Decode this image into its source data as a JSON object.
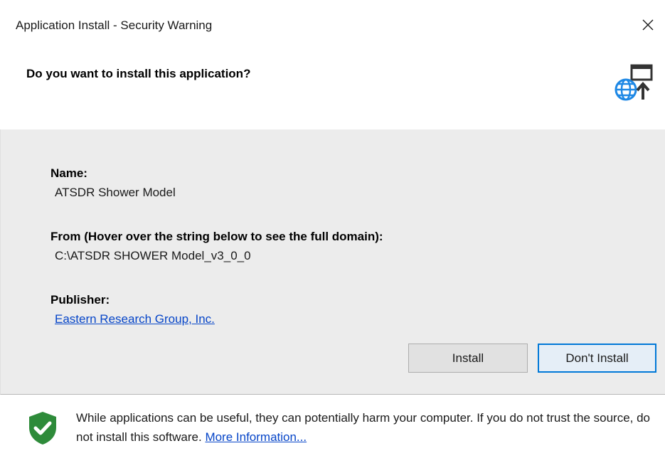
{
  "window": {
    "title": "Application Install - Security Warning",
    "close_icon": "close-icon"
  },
  "header": {
    "question": "Do you want to install this application?",
    "icon": "app-install-globe-icon"
  },
  "details": {
    "name_label": "Name:",
    "name_value": "ATSDR Shower Model",
    "from_label": "From (Hover over the string below to see the full domain):",
    "from_value": "C:\\ATSDR SHOWER Model_v3_0_0",
    "publisher_label": "Publisher:",
    "publisher_value": "Eastern Research Group, Inc."
  },
  "buttons": {
    "install": "Install",
    "dont_install": "Don't Install"
  },
  "footer": {
    "warning": "While applications can be useful, they can potentially harm your computer. If you do not trust the source, do not install this software.",
    "more_info": "More Information...",
    "shield_icon": "shield-check-icon"
  },
  "colors": {
    "link": "#0645c8",
    "accent": "#0078d7",
    "shield": "#2e8b3a",
    "body_bg": "#ececec"
  }
}
